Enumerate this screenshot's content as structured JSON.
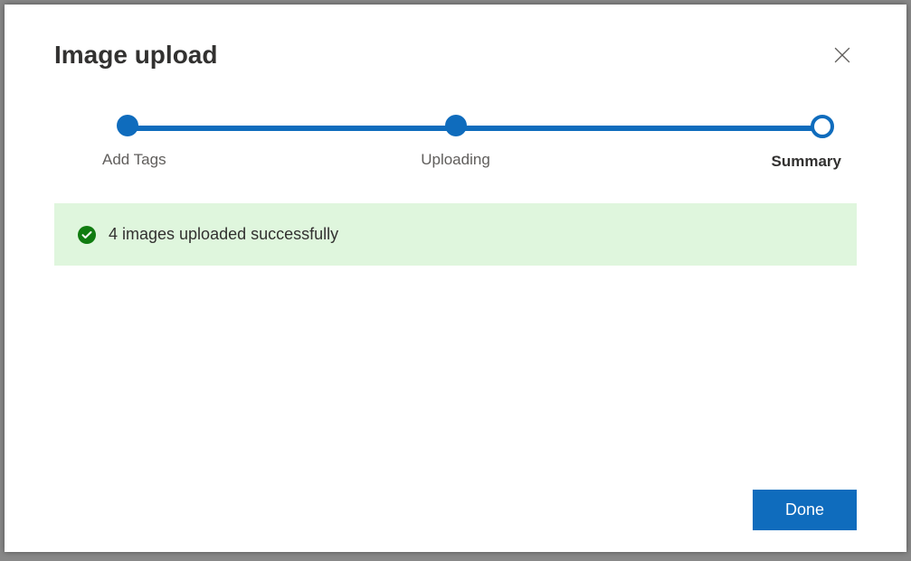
{
  "modal": {
    "title": "Image upload",
    "close_label": "Close"
  },
  "stepper": {
    "steps": [
      {
        "label": "Add Tags",
        "state": "done"
      },
      {
        "label": "Uploading",
        "state": "done"
      },
      {
        "label": "Summary",
        "state": "current"
      }
    ]
  },
  "status": {
    "icon": "success-check",
    "message": "4 images uploaded successfully"
  },
  "footer": {
    "done_label": "Done"
  },
  "colors": {
    "accent": "#0f6cbd",
    "success_bg": "#dff6dd",
    "success_icon": "#107c10"
  }
}
